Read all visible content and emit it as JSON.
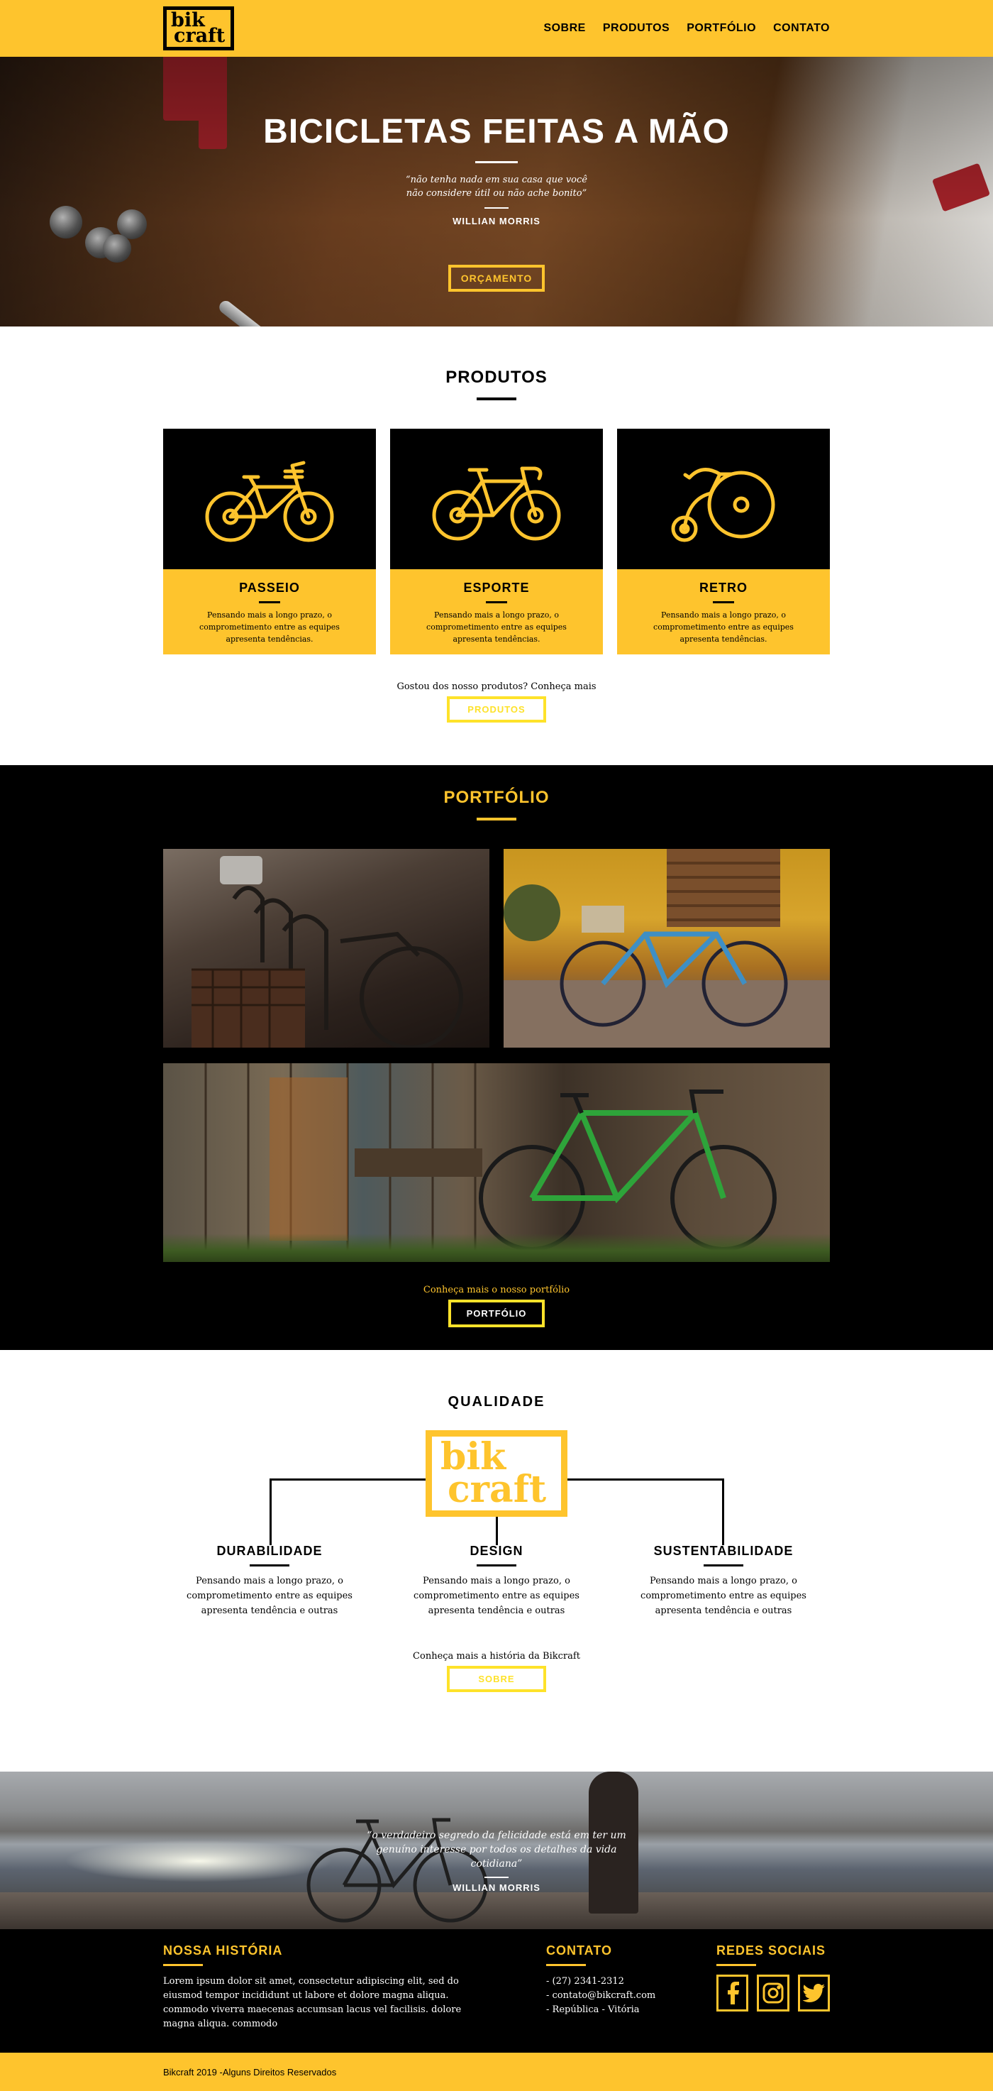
{
  "header": {
    "logo_line1": "bik",
    "logo_line2": "craft",
    "nav": [
      "SOBRE",
      "PRODUTOS",
      "PORTFÓLIO",
      "CONTATO"
    ]
  },
  "hero": {
    "title": "BICICLETAS FEITAS A MÃO",
    "quote": "“não tenha nada em sua casa que você não considere útil ou não ache bonito”",
    "author": "WILLIAN MORRIS",
    "button": "ORÇAMENTO"
  },
  "produtos": {
    "title": "PRODUTOS",
    "items": [
      {
        "name": "PASSEIO",
        "icon": "city-bike-icon",
        "text": "Pensando mais a longo prazo, o comprometimento entre as equipes apresenta tendências."
      },
      {
        "name": "ESPORTE",
        "icon": "sport-bike-icon",
        "text": "Pensando mais a longo prazo, o comprometimento entre as equipes apresenta tendências."
      },
      {
        "name": "RETRO",
        "icon": "penny-farthing-icon",
        "text": "Pensando mais a longo prazo, o comprometimento entre as equipes apresenta tendências."
      }
    ],
    "cta_text": "Gostou dos nosso produtos? Conheça mais",
    "cta_button": "PRODUTOS"
  },
  "portfolio": {
    "title": "PORTFÓLIO",
    "cta_text": "Conheça mais o nosso portfólio",
    "cta_button": "PORTFÓLIO"
  },
  "qualidade": {
    "title": "QUALIDADE",
    "logo_line1": "bik",
    "logo_line2": "craft",
    "items": [
      {
        "name": "DURABILIDADE",
        "text": "Pensando mais a longo prazo, o comprometimento entre as equipes apresenta tendência e outras"
      },
      {
        "name": "DESIGN",
        "text": "Pensando mais a longo prazo, o comprometimento entre as equipes apresenta tendência e outras"
      },
      {
        "name": "SUSTENTABILIDADE",
        "text": "Pensando mais a longo prazo, o comprometimento entre as equipes apresenta tendência e outras"
      }
    ],
    "cta_text": "Conheça mais a história da Bikcraft",
    "cta_button": "SOBRE"
  },
  "banner": {
    "quote": "“o verdadeiro segredo da felicidade está em ter um genuíno interesse por todos os detalhes da vida cotidiana”",
    "author": "WILLIAN MORRIS"
  },
  "footer": {
    "historia_title": "NOSSA HISTÓRIA",
    "historia_text": "Lorem ipsum dolor sit amet, consectetur adipiscing elit, sed do eiusmod tempor incididunt ut labore et dolore magna aliqua. commodo viverra maecenas accumsan lacus vel facilisis. dolore magna aliqua. commodo",
    "contato_title": "CONTATO",
    "contato": [
      "- (27) 2341-2312",
      "- contato@bikcraft.com",
      "- República - Vitória"
    ],
    "redes_title": "REDES SOCIAIS",
    "redes": [
      "facebook-icon",
      "instagram-icon",
      "twitter-icon"
    ],
    "copyright": "Bikcraft 2019 -Alguns Direitos Reservados"
  },
  "colors": {
    "brand_yellow": "#FEC42D",
    "button_line_yellow": "#FEE22A",
    "dark": "#000000"
  }
}
